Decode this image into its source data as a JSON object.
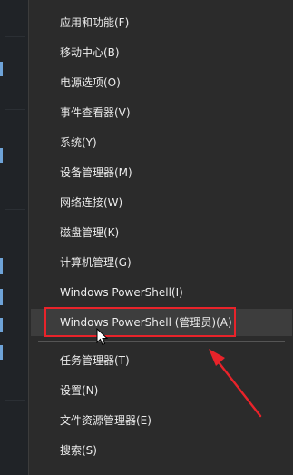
{
  "menu": {
    "items": [
      {
        "label": "应用和功能(F)"
      },
      {
        "label": "移动中心(B)"
      },
      {
        "label": "电源选项(O)"
      },
      {
        "label": "事件查看器(V)"
      },
      {
        "label": "系统(Y)"
      },
      {
        "label": "设备管理器(M)"
      },
      {
        "label": "网络连接(W)"
      },
      {
        "label": "磁盘管理(K)"
      },
      {
        "label": "计算机管理(G)"
      },
      {
        "label": "Windows PowerShell(I)"
      },
      {
        "label": "Windows PowerShell (管理员)(A)"
      },
      {
        "label": "任务管理器(T)"
      },
      {
        "label": "设置(N)"
      },
      {
        "label": "文件资源管理器(E)"
      },
      {
        "label": "搜索(S)"
      }
    ]
  },
  "annotation": {
    "highlight_color": "#e8232a",
    "highlighted_item": "Windows PowerShell (管理员)(A)"
  },
  "theme": {
    "menu_bg": "#2b2b2b",
    "hover_bg": "#3d3d3d",
    "text": "#ececec"
  },
  "icons": [
    "arrow-pointer-icon",
    "mouse-cursor-icon"
  ]
}
